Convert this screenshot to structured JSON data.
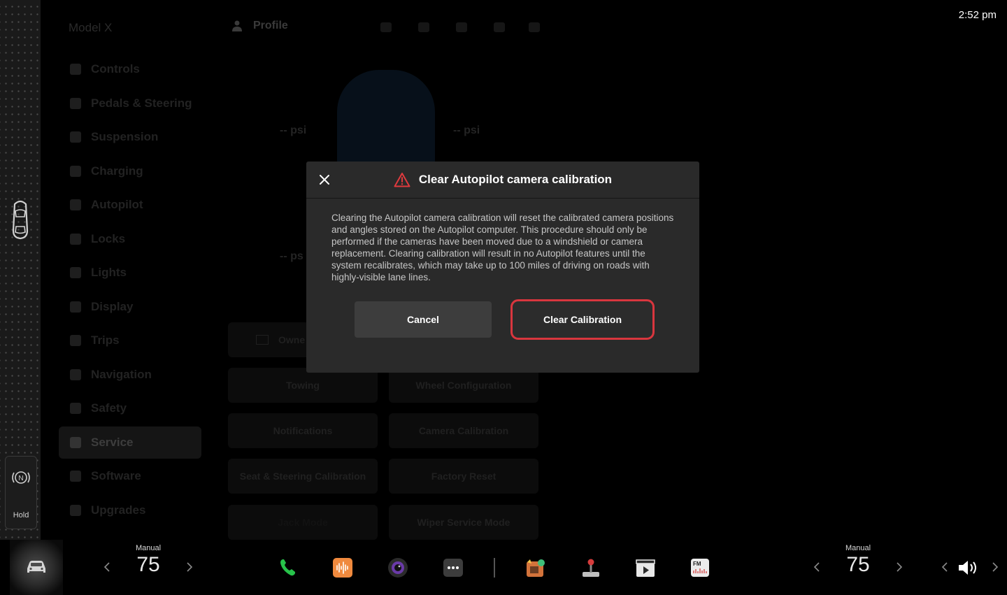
{
  "clock": "2:52 pm",
  "gear": {
    "selected": "N",
    "hold_label": "Hold"
  },
  "background_app": {
    "model_title": "Model X",
    "profile_label": "Profile",
    "nav_items": [
      {
        "label": "Controls"
      },
      {
        "label": "Pedals & Steering"
      },
      {
        "label": "Suspension"
      },
      {
        "label": "Charging"
      },
      {
        "label": "Autopilot"
      },
      {
        "label": "Locks"
      },
      {
        "label": "Lights"
      },
      {
        "label": "Display"
      },
      {
        "label": "Trips"
      },
      {
        "label": "Navigation"
      },
      {
        "label": "Safety"
      },
      {
        "label": "Service"
      },
      {
        "label": "Software"
      },
      {
        "label": "Upgrades"
      }
    ],
    "active_nav": "Service",
    "tire_psi": [
      "-- psi",
      "-- psi",
      "-- ps"
    ],
    "service_buttons": [
      "Owne",
      "Towing",
      "Wheel Configuration",
      "Notifications",
      "Camera Calibration",
      "Seat & Steering Calibration",
      "Factory Reset",
      "Jack Mode",
      "Wiper Service Mode"
    ]
  },
  "dialog": {
    "title": "Clear Autopilot camera calibration",
    "body": "Clearing the Autopilot camera calibration will reset the calibrated camera positions and angles stored on the Autopilot computer. This procedure should only be performed if the cameras have been moved due to a windshield or camera replacement. Clearing calibration will result in no Autopilot features until the system recalibrates, which may take up to 100 miles of driving on roads with highly-visible lane lines.",
    "cancel_label": "Cancel",
    "confirm_label": "Clear Calibration",
    "warning_color": "#e03a3e",
    "highlight_color": "#d9363e"
  },
  "dock": {
    "left_climate": {
      "mode": "Manual",
      "temp": "75"
    },
    "right_climate": {
      "mode": "Manual",
      "temp": "75"
    },
    "apps": [
      "phone-icon",
      "audio-icon",
      "camera-icon",
      "more-icon",
      "toybox-icon",
      "arcade-icon",
      "theater-icon",
      "radio-icon"
    ]
  }
}
